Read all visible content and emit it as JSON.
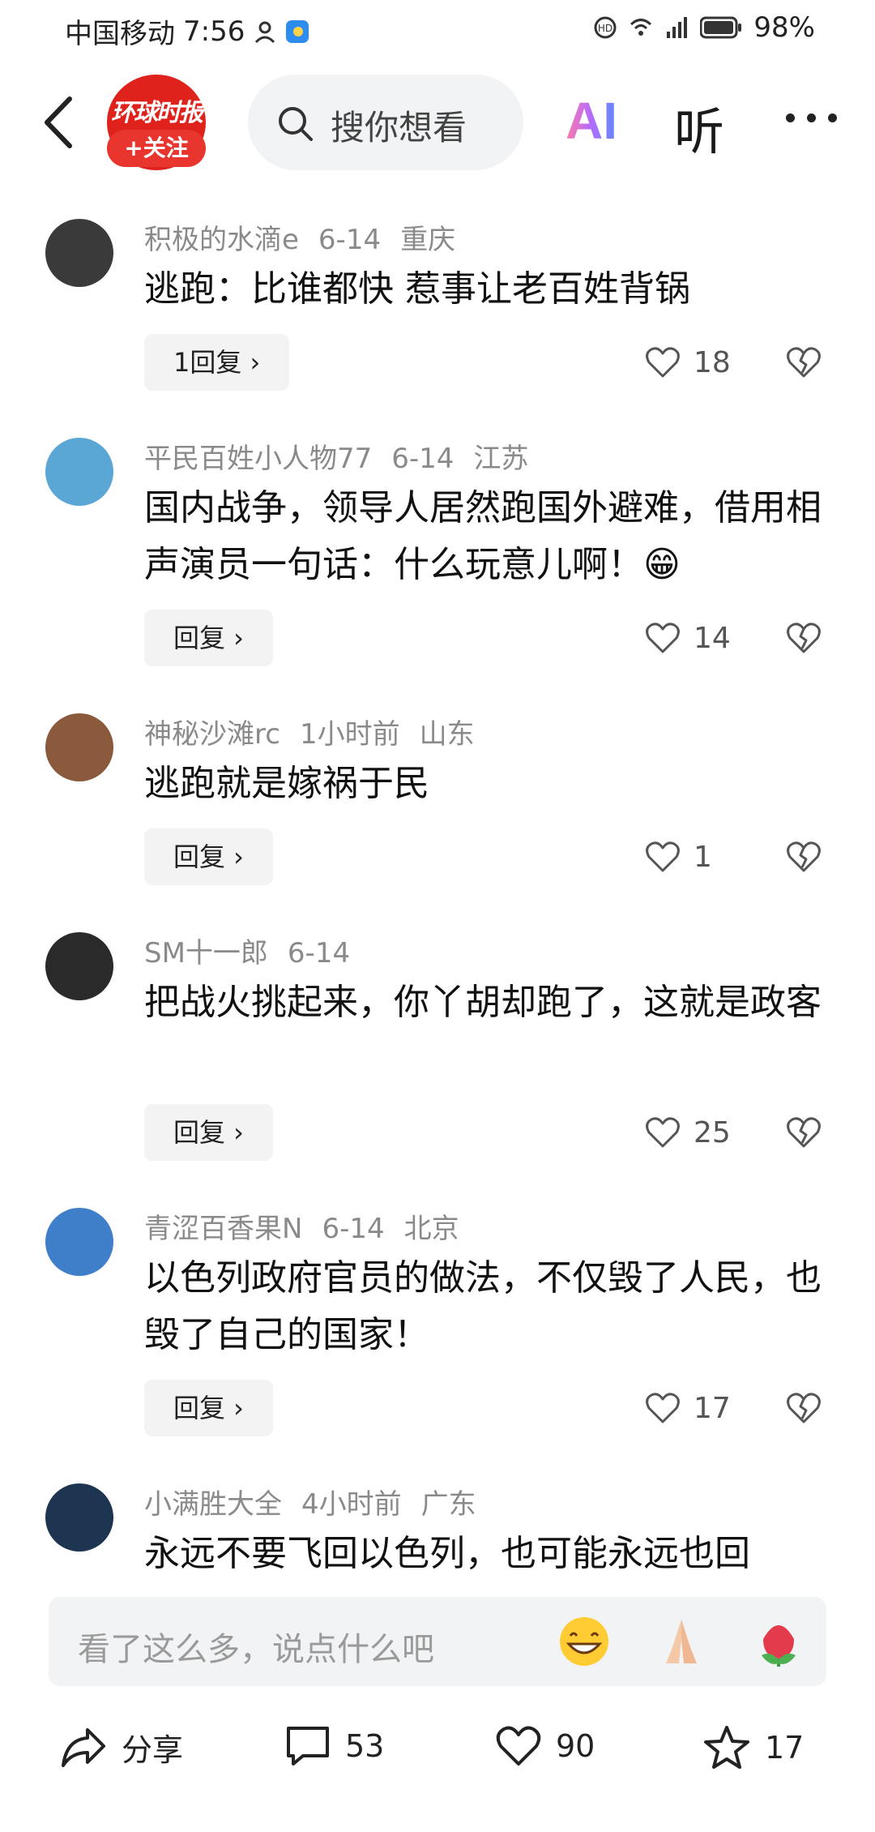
{
  "status_bar": {
    "carrier": "中国移动",
    "time": "7:56",
    "battery": "98%"
  },
  "header": {
    "logo_text": "环球时报",
    "follow_label": "+关注",
    "search_placeholder": "搜你想看",
    "ai_label": "AI",
    "listen_label": "听"
  },
  "comments": [
    {
      "user": "积极的水滴e",
      "date": "6-14",
      "location": "重庆",
      "text": "逃跑：比谁都快 惹事让老百姓背锅",
      "reply": "1回复 ›",
      "likes": "18",
      "avatar_color": "#3a3a3a"
    },
    {
      "user": "平民百姓小人物77",
      "date": "6-14",
      "location": "江苏",
      "text": "国内战争，领导人居然跑国外避难，借用相声演员一句话：什么玩意儿啊！😁",
      "reply": "回复 ›",
      "likes": "14",
      "avatar_color": "#5aa7d6"
    },
    {
      "user": "神秘沙滩rc",
      "date": "1小时前",
      "location": "山东",
      "text": "逃跑就是嫁祸于民",
      "reply": "回复 ›",
      "likes": "1",
      "avatar_color": "#8b5a3c"
    },
    {
      "user": "SM十一郎",
      "date": "6-14",
      "location": "",
      "text": "把战火挑起来，你丫胡却跑了，这就是政客",
      "reply": "回复 ›",
      "likes": "25",
      "avatar_color": "#2a2a2a"
    },
    {
      "user": "青涩百香果N",
      "date": "6-14",
      "location": "北京",
      "text": "以色列政府官员的做法，不仅毁了人民，也毁了自己的国家！",
      "reply": "回复 ›",
      "likes": "17",
      "avatar_color": "#3f7fc9"
    },
    {
      "user": "小满胜大全",
      "date": "4小时前",
      "location": "广东",
      "text": "永远不要飞回以色列，也可能永远也回",
      "reply": "",
      "likes": "",
      "avatar_color": "#1d3550"
    }
  ],
  "input": {
    "placeholder": "看了这么多，说点什么吧"
  },
  "actions": {
    "share_label": "分享",
    "comment_count": "53",
    "like_count": "90",
    "favorite_count": "17"
  }
}
